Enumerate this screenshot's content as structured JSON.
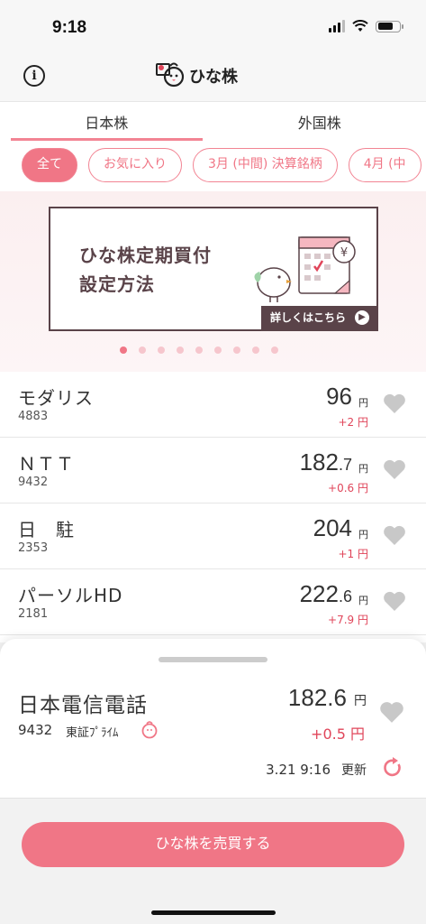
{
  "status": {
    "time": "9:18"
  },
  "header": {
    "title": "ひな株",
    "info_label": "i"
  },
  "tabs": [
    {
      "label": "日本株"
    },
    {
      "label": "外国株"
    }
  ],
  "filters": [
    {
      "label": "全て"
    },
    {
      "label": "お気に入り"
    },
    {
      "label": "3月 (中間) 決算銘柄"
    },
    {
      "label": "4月 (中"
    }
  ],
  "banner": {
    "line1": "ひな株定期買付",
    "line2": "設定方法",
    "link": "詳しくはこちら",
    "art_symbol": "¥",
    "page_count": 9,
    "current_page": 1
  },
  "stocks": [
    {
      "name": "モダリス",
      "code": "4883",
      "price_int": "96",
      "price_dec": "",
      "yen": "円",
      "change": "+2 円"
    },
    {
      "name": "ＮＴＴ",
      "code": "9432",
      "price_int": "182",
      "price_dec": ".7",
      "yen": "円",
      "change": "+0.6 円"
    },
    {
      "name": "日　駐",
      "code": "2353",
      "price_int": "204",
      "price_dec": "",
      "yen": "円",
      "change": "+1 円"
    },
    {
      "name": "パーソルHD",
      "code": "2181",
      "price_int": "222",
      "price_dec": ".6",
      "yen": "円",
      "change": "+7.9 円"
    }
  ],
  "detail": {
    "name": "日本電信電話",
    "code": "9432",
    "market": "東証ﾌﾟﾗｲﾑ",
    "price": "182.6",
    "yen": "円",
    "change": "+0.5 円",
    "updated": "3.21 9:16",
    "updated_label": "更新"
  },
  "footer": {
    "trade_label": "ひな株を売買する"
  },
  "colors": {
    "accent": "#f07686",
    "up": "#e0455a",
    "banner_dark": "#5a4349"
  }
}
